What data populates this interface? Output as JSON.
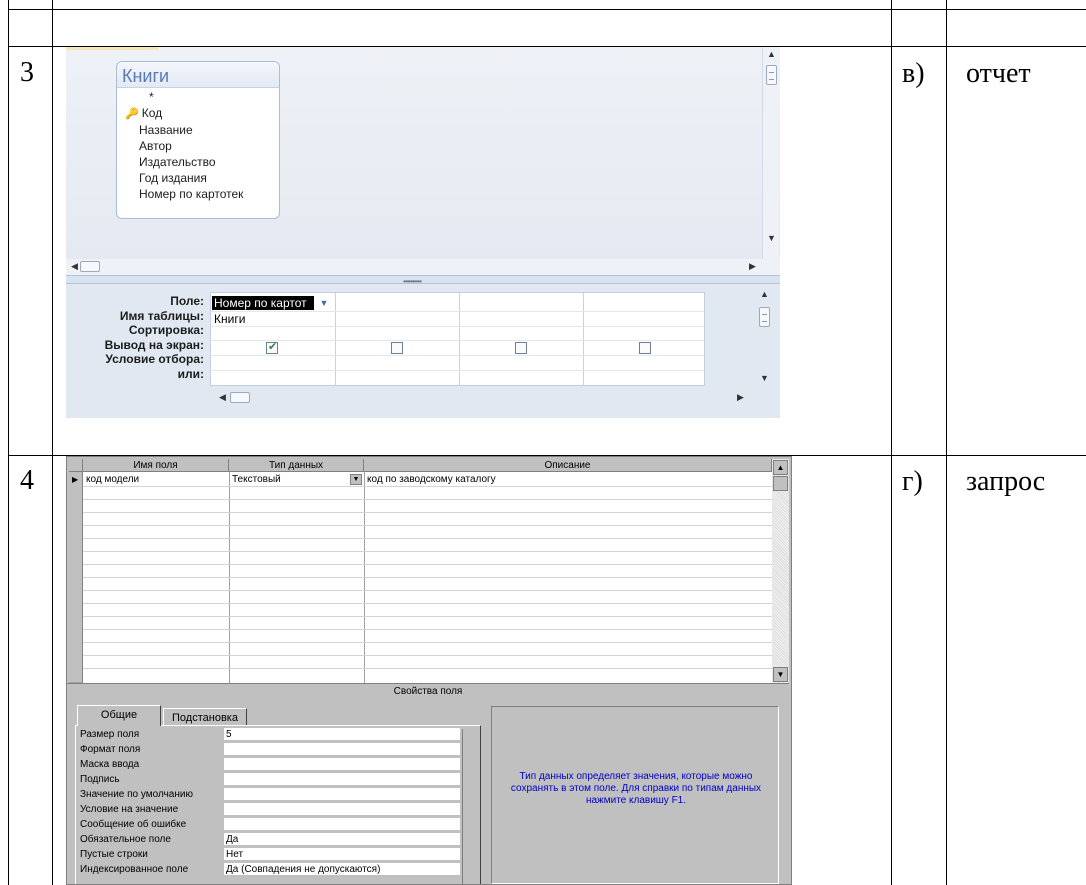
{
  "rows": [
    {
      "number": "3",
      "letter": "в)",
      "answer": "отчет"
    },
    {
      "number": "4",
      "letter": "г)",
      "answer": "запрос"
    }
  ],
  "query_designer": {
    "table_title": "Книги",
    "star": "*",
    "key_field": "Код",
    "fields": [
      "Название",
      "Автор",
      "Издательство",
      "Год издания",
      "Номер по картотек"
    ],
    "grid_row_labels": [
      "Поле:",
      "Имя таблицы:",
      "Сортировка:",
      "Вывод на экран:",
      "Условие отбора:",
      "или:"
    ],
    "selected_field": "Номер по картот",
    "table_value": "Книги",
    "show_checked": [
      true,
      false,
      false,
      false
    ]
  },
  "table_designer": {
    "headers": [
      "Имя поля",
      "Тип данных",
      "Описание"
    ],
    "first_row": {
      "name": "код модели",
      "type": "Текстовый",
      "description": "код по заводскому каталогу"
    },
    "properties_title": "Свойства поля",
    "tabs": [
      "Общие",
      "Подстановка"
    ],
    "properties": [
      {
        "label": "Размер поля",
        "value": "5"
      },
      {
        "label": "Формат поля",
        "value": ""
      },
      {
        "label": "Маска ввода",
        "value": ""
      },
      {
        "label": "Подпись",
        "value": ""
      },
      {
        "label": "Значение по умолчанию",
        "value": ""
      },
      {
        "label": "Условие на значение",
        "value": ""
      },
      {
        "label": "Сообщение об ошибке",
        "value": ""
      },
      {
        "label": "Обязательное поле",
        "value": "Да"
      },
      {
        "label": "Пустые строки",
        "value": "Нет"
      },
      {
        "label": "Индексированное поле",
        "value": "Да (Совпадения не допускаются)"
      }
    ],
    "help_text": "Тип данных определяет значения, которые можно сохранять в этом поле.  Для справки по типам данных нажмите клавишу F1."
  }
}
